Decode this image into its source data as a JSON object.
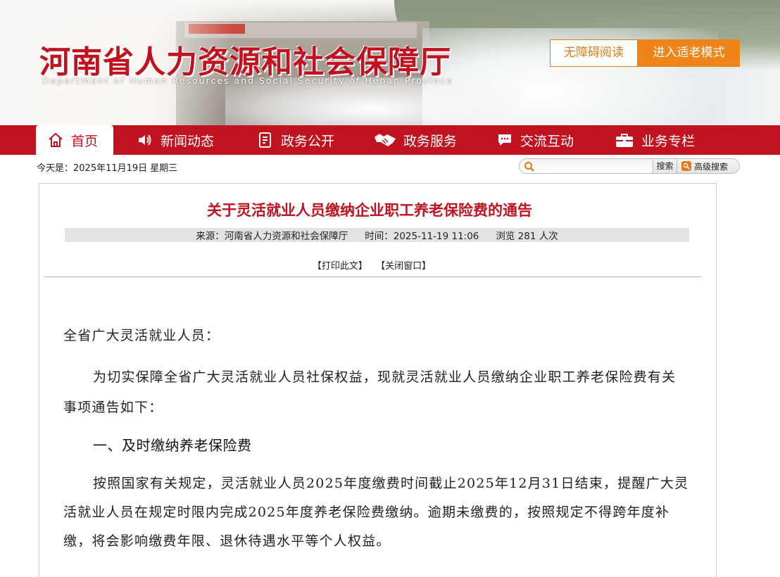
{
  "header": {
    "title": "河南省人力资源和社会保障厅",
    "subtitle": "Department of Human Resources and Social Security of Henan Province",
    "accessible_label": "无障碍阅读",
    "elder_label": "进入适老模式"
  },
  "nav": {
    "items": [
      {
        "label": "首页",
        "icon": "home-icon"
      },
      {
        "label": "新闻动态",
        "icon": "speaker-icon"
      },
      {
        "label": "政务公开",
        "icon": "document-icon"
      },
      {
        "label": "政务服务",
        "icon": "handshake-icon"
      },
      {
        "label": "交流互动",
        "icon": "chat-icon"
      },
      {
        "label": "业务专栏",
        "icon": "briefcase-icon"
      }
    ]
  },
  "date_line": "今天是：2025年11月19日 星期三",
  "search": {
    "placeholder": "",
    "button": "搜索",
    "advanced": "高级搜索"
  },
  "article": {
    "title": "关于灵活就业人员缴纳企业职工养老保险费的通告",
    "source": "来源：河南省人力资源和社会保障厅",
    "time": "时间：2025-11-19 11:06",
    "views": "浏览 281 人次",
    "print": "【打印此文】",
    "close": "【关闭窗口】",
    "greeting": "全省广大灵活就业人员：",
    "para1": "为切实保障全省广大灵活就业人员社保权益，现就灵活就业人员缴纳企业职工养老保险费有关事项通告如下：",
    "heading1": "一、及时缴纳养老保险费",
    "para2": "按照国家有关规定，灵活就业人员2025年度缴费时间截止2025年12月31日结束，提醒广大灵活就业人员在规定时限内完成2025年度养老保险费缴纳。逾期未缴费的，按照规定不得跨年度补缴，将会影响缴费年限、退休待遇水平等个人权益。"
  },
  "colors": {
    "brand_red": "#c1121f",
    "accent_orange": "#ef8519"
  }
}
